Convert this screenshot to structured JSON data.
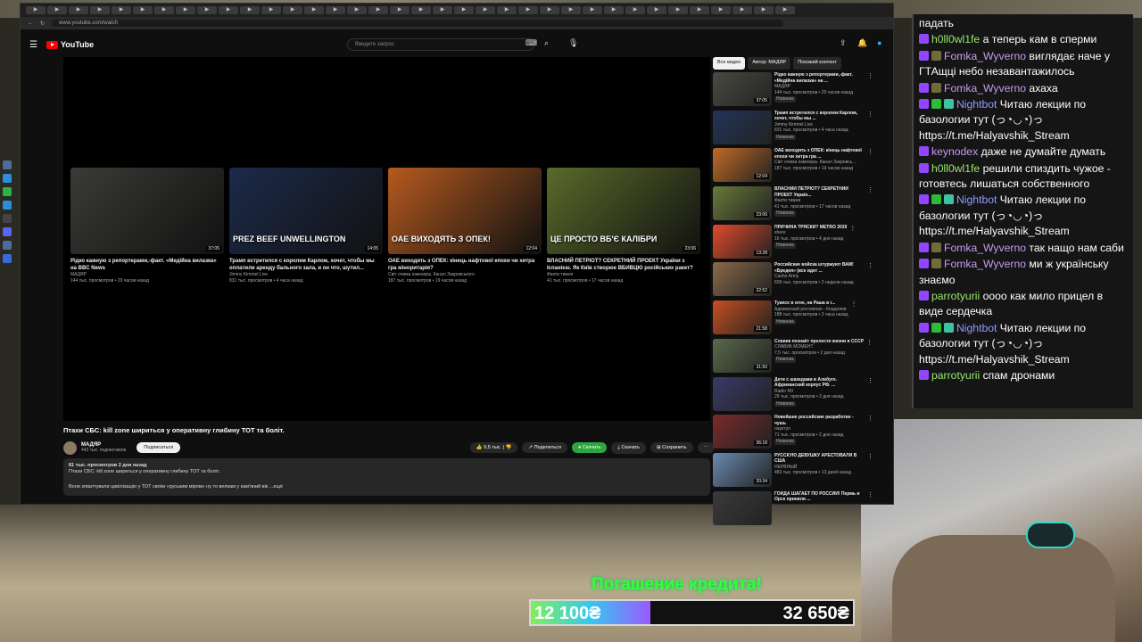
{
  "browser": {
    "url": "www.youtube.com/watch",
    "tabs": [
      "▶",
      "▶",
      "▶",
      "▶",
      "▶",
      "▶",
      "▶",
      "▶",
      "▶",
      "▶",
      "▶",
      "▶",
      "▶",
      "▶",
      "▶",
      "▶",
      "▶",
      "▶",
      "▶",
      "▶",
      "▶",
      "▶",
      "▶",
      "▶",
      "▶",
      "▶",
      "▶",
      "▶",
      "▶",
      "▶",
      "▶",
      "▶",
      "▶",
      "▶",
      "▶",
      "▶"
    ]
  },
  "youtube": {
    "logo": "YouTube",
    "search_placeholder": "Введите запрос",
    "end_cards": [
      {
        "title": "Рідко кажную з репортерами,-факт. «Медійна вилазка» на BBC News",
        "channel": "МАДЯР",
        "meta": "144 тыс. просмотров • 20 часов назад",
        "duration": "37:05",
        "color": "#3b3a36"
      },
      {
        "title": "Трамп встретился с королем Карлом, хочет, чтобы мы оплатили аренду бального зала, и он что, шутил...",
        "channel": "Jimmy Kimmel Live",
        "meta": "831 тыс. просмотров • 4 часа назад",
        "duration": "14:05",
        "overlay": "PREZ BEEF UNWELLINGTON",
        "color": "#1c2a4a"
      },
      {
        "title": "ОАЕ виходять з ОПЕК: кінець нафтової епохи чи хитра гра міноритарія?",
        "channel": "Світ очима інженера. Канал Закревського",
        "meta": "187 тыс. просмотров • 19 часов назад",
        "duration": "12:04",
        "overlay": "ОАЕ ВИХОДЯТЬ З ОПЕК!",
        "color": "#b65a1e"
      },
      {
        "title": "ВЛАСНИЙ ПЕТРІОТ? СЕКРЕТНИЙ ПРОЕКТ України з Іспанією. Як Київ створює ВБИВЦЮ російських ракет?",
        "channel": "Факти тижня",
        "meta": "41 тыс. просмотров • 17 часов назад",
        "duration": "23:06",
        "overlay": "ЦЕ ПРОСТО ВБ'Є КАЛІБРИ",
        "color": "#5a6a2a"
      }
    ],
    "video_title": "Птахи СБС: kill zone шириться у оперативну глибину ТОТ та боліт.",
    "channel": {
      "name": "МАДЯР",
      "subs": "443 тыс. подписчиков",
      "subscribe_label": "Подписаться"
    },
    "actions": {
      "likes": "9,5 тыс.",
      "share": "Поделиться",
      "download_save": "Скачать",
      "download": "Скачать",
      "save": "Сохранить"
    },
    "description": {
      "meta": "81 тыс. просмотров  2 дня назад",
      "line1": "Птахи СБС: kill zone шириться у оперативну глибину ТОТ та боліт.",
      "line2": "Вони згвалтували цивілізацію у ТОТ своїм «руським міром» ну то велкам у кам'яний вік   ...ещё"
    },
    "chips": [
      "Все видео",
      "Автор: МАДЯР",
      "Похожий контент"
    ],
    "sidebar": [
      {
        "title": "Рідко кажную з репортерами,-факт. «Медійна вилазка» на ...",
        "channel": "МАДЯР",
        "meta": "144 тыс. просмотров • 20 часов назад",
        "badge": "Новинка",
        "dur": "37:05",
        "color": "#4a4a42"
      },
      {
        "title": "Трамп встретился с королем Карлом, хочет, чтобы мы ...",
        "channel": "Jimmy Kimmel Live",
        "meta": "831 тыс. просмотров • 4 часа назад",
        "badge": "Новинка",
        "dur": "",
        "color": "#22345a"
      },
      {
        "title": "ОАЕ виходять з ОПЕК: кінець нафтової епохи чи хитра гра ...",
        "channel": "Світ очима інженера. Канал Закревсь...",
        "meta": "187 тыс. просмотров • 19 часов назад",
        "badge": "",
        "dur": "12:04",
        "color": "#c26a26"
      },
      {
        "title": "ВЛАСНИЙ ПЕТРІОТ? СЕКРЕТНИЙ ПРОЕКТ Україн...",
        "channel": "Факти тижня",
        "meta": "41 тыс. просмотров • 17 часов назад",
        "badge": "Новинка",
        "dur": "23:06",
        "color": "#6a7a3a"
      },
      {
        "title": "ПРИЧИНА ТРЯСКИ? METRO 2039",
        "channel": "shere",
        "meta": "16 тыс. просмотров • 4 дня назад",
        "badge": "Новинка",
        "dur": "13:28",
        "color": "#e24a2a"
      },
      {
        "title": "Российские войска штурмуют ВАМ! «Бредея» (все идет ...",
        "channel": "Сashe Army",
        "meta": "609 тыс. просмотров • 2 недели назад",
        "badge": "",
        "dur": "22:52",
        "color": "#8a6a4a"
      },
      {
        "title": "Туапсе в огне, на Раша в г...",
        "channel": "Адекватный россиянин - Кнадляев",
        "meta": "188 тыс. просмотров • 3 часа назад",
        "badge": "Новинка",
        "dur": "21:58",
        "color": "#c5501e"
      },
      {
        "title": "Славик познаёт прелести жизни в СССР",
        "channel": "СЛАВИК МОМЕНТ",
        "meta": "7,5 тыс. просмотров • 2 дня назад",
        "badge": "Новинка",
        "dur": "31:50",
        "color": "#5a6a4a"
      },
      {
        "title": "Дети с шахедами в Алабуге. Африканский корпус РФ. ...",
        "channel": "Radio NV",
        "meta": "29 тыс. просмотров • 3 дня назад",
        "badge": "Новинка",
        "dur": "",
        "color": "#3a3a6a"
      },
      {
        "title": "Новейшие российские разработки - чушь",
        "channel": "науктуп",
        "meta": "71 тыс. просмотров • 2 дня назад",
        "badge": "Новинка",
        "dur": "36:18",
        "color": "#7a2a2a"
      },
      {
        "title": "РУССКУЮ ДЕВУШКУ АРЕСТОВАЛИ В США",
        "channel": "НЕРВНЫЙ",
        "meta": "483 тыс. просмотров • 13 дней назад",
        "badge": "",
        "dur": "20:34",
        "color": "#6a8ab0"
      },
      {
        "title": "ГОЙДА ШАГАЕТ ПО РОССИИ! Пермь и Орск приняли ...",
        "channel": "",
        "meta": "",
        "badge": "",
        "dur": "",
        "color": "#3a3a3a"
      }
    ]
  },
  "chat": [
    {
      "user": "",
      "text": "падать",
      "color": "#ffffff",
      "badges": []
    },
    {
      "user": "h0ll0wl1fe",
      "text": "а теперь кам в сперми",
      "color": "#9ae66e",
      "badges": [
        "tw"
      ]
    },
    {
      "user": "Fomka_Wyverno",
      "text": "виглядає наче у ГТАщці небо незавантажилось",
      "color": "#c79bf2",
      "badges": [
        "tw",
        "sub"
      ]
    },
    {
      "user": "Fomka_Wyverno",
      "text": "ахаха",
      "color": "#c79bf2",
      "badges": [
        "tw",
        "sub"
      ]
    },
    {
      "user": "Nightbot",
      "text": "Читаю лекции по базологии тут (っ◔◡◔)っ https://t.me/Halyavshik_Stream",
      "color": "#8c9dff",
      "badges": [
        "tw",
        "mod",
        "vip"
      ]
    },
    {
      "user": "keynodex",
      "text": "даже не думайте думать",
      "color": "#c79bf2",
      "badges": [
        "tw"
      ]
    },
    {
      "user": "h0ll0wl1fe",
      "text": "решили спиздить чужое - готовтесь лишаться собственного",
      "color": "#9ae66e",
      "badges": [
        "tw"
      ]
    },
    {
      "user": "Nightbot",
      "text": "Читаю лекции по базологии тут (っ◔◡◔)っ https://t.me/Halyavshik_Stream",
      "color": "#8c9dff",
      "badges": [
        "tw",
        "mod",
        "vip"
      ]
    },
    {
      "user": "Fomka_Wyverno",
      "text": "так нащо нам саби",
      "color": "#c79bf2",
      "badges": [
        "tw",
        "sub"
      ]
    },
    {
      "user": "Fomka_Wyverno",
      "text": "ми ж українську знаємо",
      "color": "#c79bf2",
      "badges": [
        "tw",
        "sub"
      ]
    },
    {
      "user": "parrotyurii",
      "text": "оооо как мило прицел в виде сердечка",
      "color": "#9ae66e",
      "badges": [
        "tw"
      ]
    },
    {
      "user": "Nightbot",
      "text": "Читаю лекции по базологии тут (っ◔◡◔)っ https://t.me/Halyavshik_Stream",
      "color": "#8c9dff",
      "badges": [
        "tw",
        "mod",
        "vip"
      ]
    },
    {
      "user": "parrotyurii",
      "text": "спам дронами",
      "color": "#9ae66e",
      "badges": [
        "tw"
      ]
    }
  ],
  "donation": {
    "title": "Погашение кредита!",
    "current": "12 100₴",
    "goal": "32 650₴",
    "progress": 0.37
  }
}
